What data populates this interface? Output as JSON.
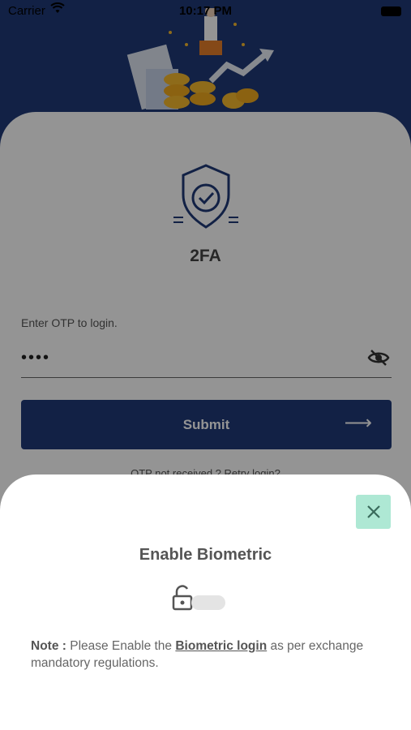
{
  "status_bar": {
    "carrier": "Carrier",
    "time": "10:17 PM"
  },
  "screen": {
    "title": "2FA",
    "otp_label": "Enter OTP to login.",
    "otp_value": "••••",
    "submit_label": "Submit",
    "submit_arrow": "⟶",
    "retry_text": "OTP not received ? Retry login?"
  },
  "sheet": {
    "title": "Enable Biometric",
    "toggle_on": false,
    "note_prefix": "Note :",
    "note_text_1": " Please Enable the ",
    "note_link": "Biometric login",
    "note_text_2": " as per exchange mandatory regulations."
  },
  "colors": {
    "primary": "#1f3a78",
    "close_bg": "#aee8d4",
    "accent_gold": "#f5b82e"
  }
}
